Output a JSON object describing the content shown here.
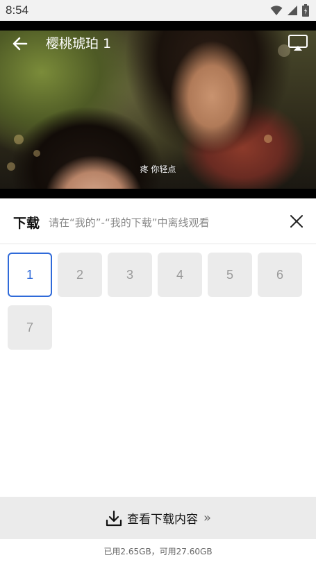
{
  "status_bar": {
    "time": "8:54",
    "icons": [
      "wifi-icon",
      "signal-icon",
      "battery-icon"
    ]
  },
  "video": {
    "title": "樱桃琥珀 1",
    "subtitle": "疼 你轻点"
  },
  "download_panel": {
    "title": "下载",
    "hint": "请在“我的”-“我的下载”中离线观看",
    "episodes": [
      "1",
      "2",
      "3",
      "4",
      "5",
      "6",
      "7"
    ],
    "selected_episode": "1"
  },
  "footer": {
    "view_downloads_label": "查看下载内容",
    "chevron": "»",
    "storage_text": "已用2.65GB，可用27.60GB"
  },
  "colors": {
    "accent": "#2f6ad9",
    "tile_bg": "#ebebeb",
    "tile_text": "#9a9a9a"
  }
}
